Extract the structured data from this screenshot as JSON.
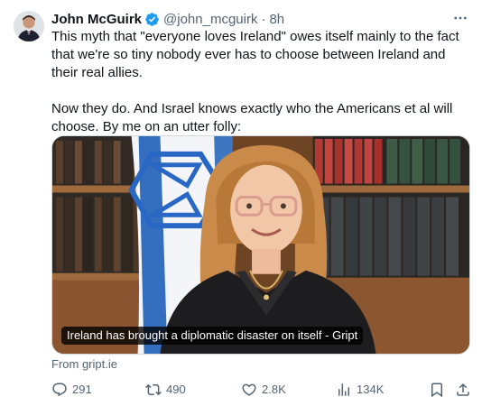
{
  "tweet": {
    "author": {
      "name": "John McGuirk",
      "handle": "@john_mcguirk",
      "time": "8h"
    },
    "text": "This myth that \"everyone loves Ireland\" owes itself mainly to the fact that we're so tiny nobody ever has to choose between Ireland and their real allies.\n\nNow they do. And Israel knows exactly who the Americans et al will choose. By me on an utter folly:",
    "card": {
      "caption": "Ireland has brought a diplomatic disaster on itself - Gript",
      "source": "From gript.ie"
    },
    "actions": {
      "replies": "291",
      "reposts": "490",
      "likes": "2.8K",
      "views": "134K"
    },
    "colors": {
      "verified": "#1d9bf0",
      "secondary_text": "#536471",
      "primary_text": "#0f1419"
    }
  },
  "icons": {
    "more": "more-horizontal-icon",
    "reply": "reply-icon",
    "repost": "repost-icon",
    "like": "heart-icon",
    "views": "views-chart-icon",
    "bookmark": "bookmark-icon",
    "share": "share-icon"
  }
}
